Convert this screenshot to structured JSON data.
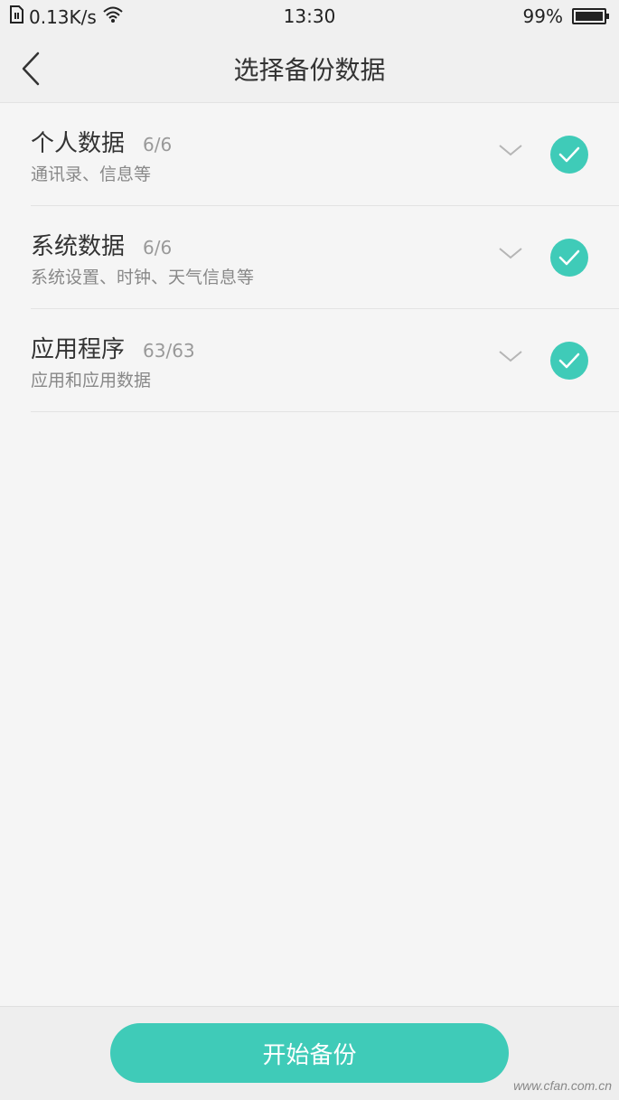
{
  "status_bar": {
    "network_speed": "0.13K/s",
    "time": "13:30",
    "battery_percent": "99%",
    "battery_level": 0.99,
    "icons": [
      "sim-icon",
      "wifi-icon",
      "battery-icon"
    ]
  },
  "header": {
    "title": "选择备份数据"
  },
  "items": [
    {
      "title": "个人数据",
      "count": "6/6",
      "subtitle": "通讯录、信息等",
      "checked": true
    },
    {
      "title": "系统数据",
      "count": "6/6",
      "subtitle": "系统设置、时钟、天气信息等",
      "checked": true
    },
    {
      "title": "应用程序",
      "count": "63/63",
      "subtitle": "应用和应用数据",
      "checked": true
    }
  ],
  "footer": {
    "start_label": "开始备份"
  },
  "watermark": "www.cfan.com.cn",
  "colors": {
    "accent": "#3fcbb8",
    "background": "#f5f5f5",
    "header_bg": "#f0f0f0"
  }
}
